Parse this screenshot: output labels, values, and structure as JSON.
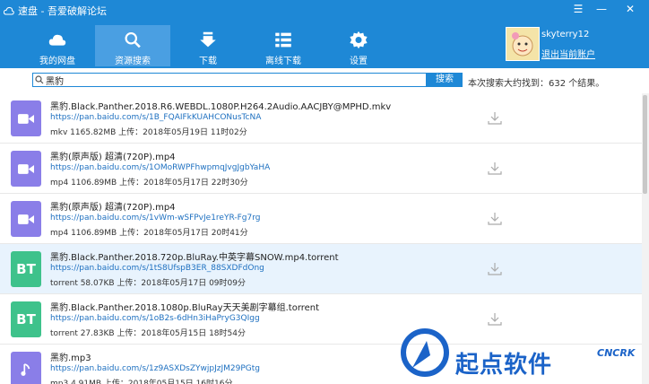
{
  "window": {
    "title": "速盘 - 吾爱破解论坛",
    "min_label": "—",
    "max_label": "☐",
    "close_label": "✕",
    "menu_label": "☰"
  },
  "tabs": [
    {
      "label": "我的网盘",
      "icon": "cloud-icon"
    },
    {
      "label": "资源搜索",
      "icon": "search-icon"
    },
    {
      "label": "下载",
      "icon": "download-icon"
    },
    {
      "label": "离线下载",
      "icon": "list-icon"
    },
    {
      "label": "设置",
      "icon": "gear-icon"
    }
  ],
  "user": {
    "name": "skyterry12",
    "logout": "退出当前账户"
  },
  "search": {
    "value": "黑豹",
    "button": "搜索",
    "result_text": "本次搜索大约找到：632 个结果。"
  },
  "files": [
    {
      "name": "黑豹.Black.Panther.2018.R6.WEBDL.1080P.H264.2Audio.AACJBY@MPHD.mkv",
      "url": "https://pan.baidu.com/s/1B_FQAIFkKUAHCONusTcNA",
      "meta": "mkv  1165.82MB 上传：2018年05月19日 11时02分",
      "type": "video",
      "color": "#8a7ee8"
    },
    {
      "name": "黑豹(原声版) 超清(720P).mp4",
      "url": "https://pan.baidu.com/s/1OMoRWPFhwpmqJvgJgbYaHA",
      "meta": "mp4  1106.89MB 上传：2018年05月17日 22时30分",
      "type": "video",
      "color": "#8a7ee8"
    },
    {
      "name": "黑豹(原声版) 超清(720P).mp4",
      "url": "https://pan.baidu.com/s/1vWm-wSFPvJe1reYR-Fg7rg",
      "meta": "mp4  1106.89MB 上传：2018年05月17日 20时41分",
      "type": "video",
      "color": "#8a7ee8"
    },
    {
      "name": "黑豹.Black.Panther.2018.720p.BluRay.中英字幕SNOW.mp4.torrent",
      "url": "https://pan.baidu.com/s/1tS8UfspB3ER_88SXDFdOng",
      "meta": "torrent  58.07KB 上传：2018年05月17日 09时09分",
      "type": "BT",
      "color": "#3ec28b"
    },
    {
      "name": "黑豹.Black.Panther.2018.1080p.BluRay天天美剧字幕组.torrent",
      "url": "https://pan.baidu.com/s/1oB2s-6dHn3iHaPryG3QIgg",
      "meta": "torrent  27.83KB 上传：2018年05月15日 18时54分",
      "type": "BT",
      "color": "#3ec28b"
    },
    {
      "name": "黑豹.mp3",
      "url": "https://pan.baidu.com/s/1z9ASXDsZYwjpJzJM29PGtg",
      "meta": "mp3  4.91MB 上传：2018年05月15日 16时16分",
      "type": "audio",
      "color": "#8a7ee8"
    }
  ],
  "watermark": {
    "title": "起点软件",
    "code": "CNCRK"
  }
}
